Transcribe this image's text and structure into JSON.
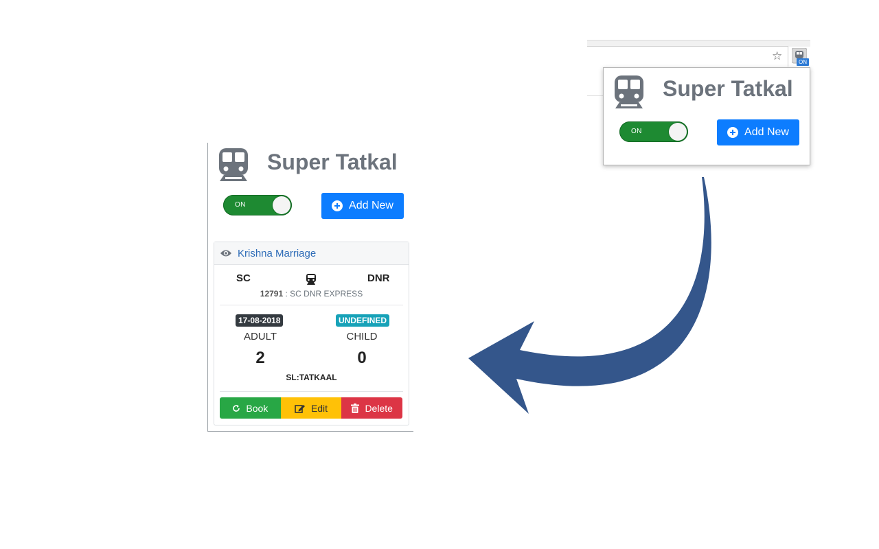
{
  "app": {
    "title": "Super Tatkal",
    "toggle_label": "ON",
    "add_new_label": "Add New"
  },
  "browser": {
    "extension_badge": "ON"
  },
  "booking": {
    "name": "Krishna Marriage",
    "from": "SC",
    "to": "DNR",
    "train_number": "12791",
    "train_name": ": SC DNR EXPRESS",
    "date": "17-08-2018",
    "status": "UNDEFINED",
    "adult_label": "ADULT",
    "adult_count": "2",
    "child_label": "CHILD",
    "child_count": "0",
    "quota": "SL:TATKAAL"
  },
  "actions": {
    "book": "Book",
    "edit": "Edit",
    "delete": "Delete"
  },
  "colors": {
    "primary": "#0d7dff",
    "toggle_on": "#1e8a32",
    "book": "#28a745",
    "edit": "#ffc107",
    "delete": "#dc3545",
    "badge_date": "#343a40",
    "badge_status": "#17a2b8",
    "arrow": "#34568b"
  }
}
